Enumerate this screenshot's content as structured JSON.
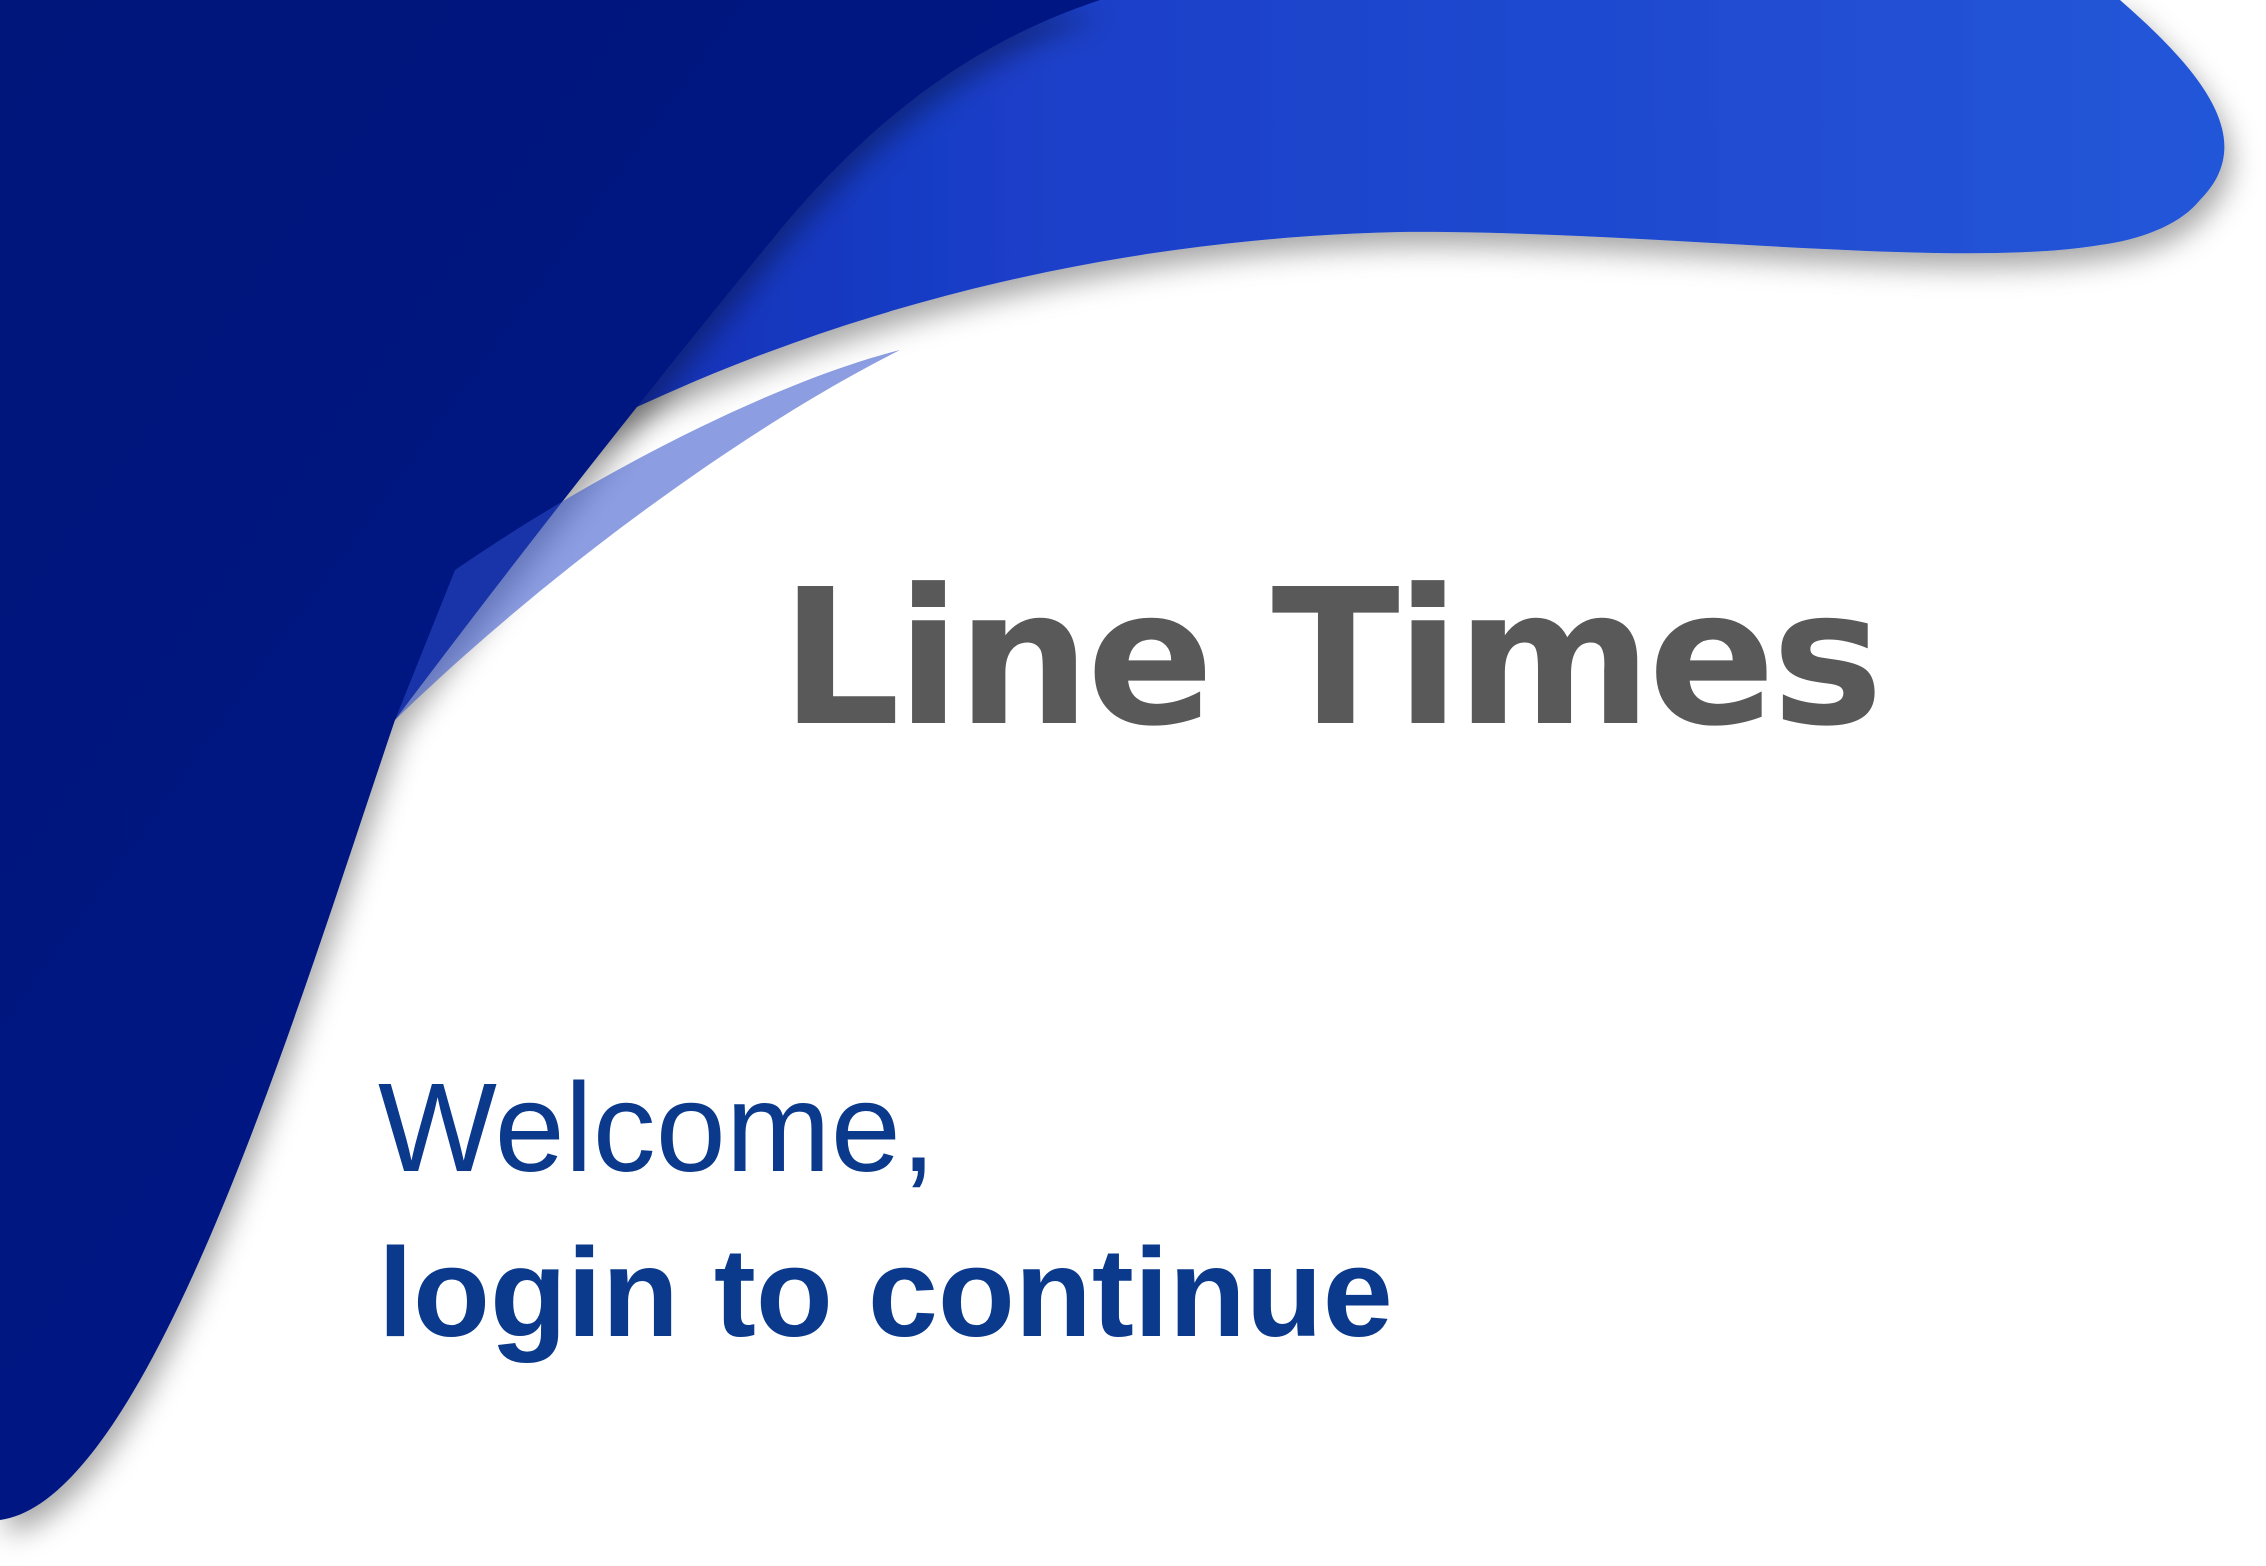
{
  "app": {
    "title": "Line Times"
  },
  "greeting": {
    "welcome": "Welcome,",
    "prompt": "login to continue"
  },
  "colors": {
    "title_text": "#595959",
    "greeting_text": "#0b3a8c",
    "wave_dark": "#061680",
    "wave_mid": "#0a22a6",
    "wave_light": "#2456d8",
    "background": "#ffffff"
  }
}
